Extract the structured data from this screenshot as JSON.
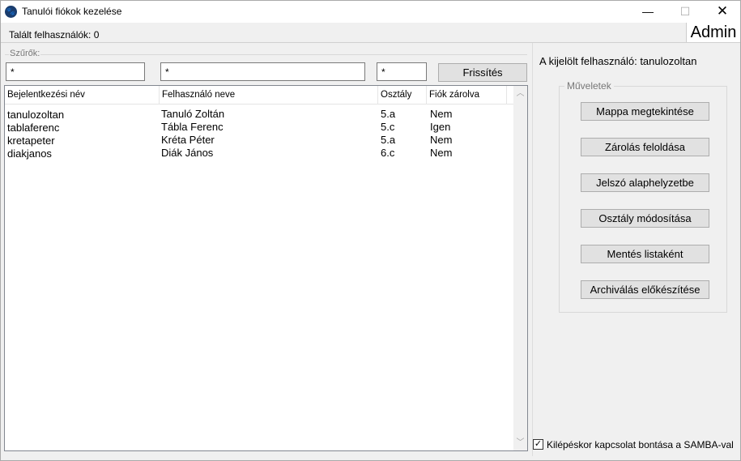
{
  "window": {
    "title": "Tanulói fiókok kezelése",
    "icon": "paw-icon",
    "minimize": "—",
    "maximize": "☐",
    "close": "✕"
  },
  "status": {
    "found_users": "Talált felhasználók: 0",
    "role": "Admin"
  },
  "filters": {
    "label": "Szűrők:",
    "login_filter": "*",
    "name_filter": "*",
    "class_filter": "*",
    "refresh_label": "Frissítés"
  },
  "table": {
    "columns": [
      "Bejelentkezési név",
      "Felhasználó neve",
      "Osztály",
      "Fiók zárolva"
    ],
    "rows": [
      [
        "tanulozoltan",
        "Tanuló Zoltán",
        "5.a",
        "Nem"
      ],
      [
        "tablaferenc",
        "Tábla Ferenc",
        "5.c",
        "Igen"
      ],
      [
        "kretapeter",
        "Kréta Péter",
        "5.a",
        "Nem"
      ],
      [
        "diakjanos",
        "Diák János",
        "6.c",
        "Nem"
      ]
    ]
  },
  "selected_user": {
    "label": "A kijelölt felhasználó:",
    "value": "tanulozoltan"
  },
  "operations": {
    "label": "Műveletek",
    "buttons": [
      "Mappa megtekintése",
      "Zárolás feloldása",
      "Jelszó alaphelyzetbe",
      "Osztály módosítása",
      "Mentés listaként",
      "Archiválás előkészítése"
    ]
  },
  "logout_option": {
    "checked": true,
    "label": "Kilépéskor  kapcsolat bontása a SAMBA-val"
  }
}
